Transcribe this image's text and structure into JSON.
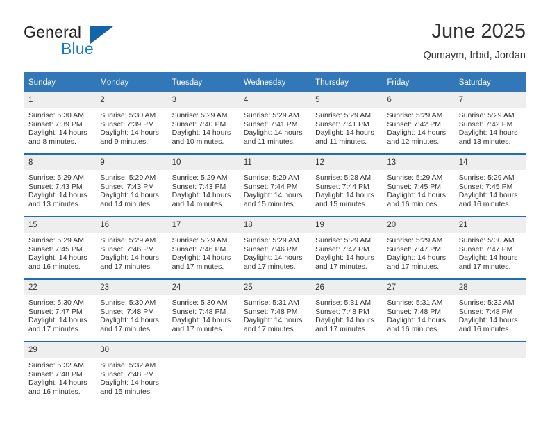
{
  "brand": {
    "word1": "General",
    "word2": "Blue",
    "triangle_color": "#1464aa",
    "blue_text_color": "#1878c8"
  },
  "header": {
    "title": "June 2025",
    "subtitle": "Qumaym, Irbid, Jordan"
  },
  "theme": {
    "header_bg": "#3277b8",
    "row_divider": "#1f6db5",
    "daynum_bg": "#eeeeee",
    "text": "#333333"
  },
  "labels": {
    "sunrise_prefix": "Sunrise:",
    "sunset_prefix": "Sunset:",
    "daylight_prefix": "Daylight:"
  },
  "weekdays": [
    "Sunday",
    "Monday",
    "Tuesday",
    "Wednesday",
    "Thursday",
    "Friday",
    "Saturday"
  ],
  "weeks": [
    [
      {
        "day": "1",
        "sunrise": "Sunrise: 5:30 AM",
        "sunset": "Sunset: 7:39 PM",
        "daylight_l1": "Daylight: 14 hours",
        "daylight_l2": "and 8 minutes."
      },
      {
        "day": "2",
        "sunrise": "Sunrise: 5:30 AM",
        "sunset": "Sunset: 7:39 PM",
        "daylight_l1": "Daylight: 14 hours",
        "daylight_l2": "and 9 minutes."
      },
      {
        "day": "3",
        "sunrise": "Sunrise: 5:29 AM",
        "sunset": "Sunset: 7:40 PM",
        "daylight_l1": "Daylight: 14 hours",
        "daylight_l2": "and 10 minutes."
      },
      {
        "day": "4",
        "sunrise": "Sunrise: 5:29 AM",
        "sunset": "Sunset: 7:41 PM",
        "daylight_l1": "Daylight: 14 hours",
        "daylight_l2": "and 11 minutes."
      },
      {
        "day": "5",
        "sunrise": "Sunrise: 5:29 AM",
        "sunset": "Sunset: 7:41 PM",
        "daylight_l1": "Daylight: 14 hours",
        "daylight_l2": "and 11 minutes."
      },
      {
        "day": "6",
        "sunrise": "Sunrise: 5:29 AM",
        "sunset": "Sunset: 7:42 PM",
        "daylight_l1": "Daylight: 14 hours",
        "daylight_l2": "and 12 minutes."
      },
      {
        "day": "7",
        "sunrise": "Sunrise: 5:29 AM",
        "sunset": "Sunset: 7:42 PM",
        "daylight_l1": "Daylight: 14 hours",
        "daylight_l2": "and 13 minutes."
      }
    ],
    [
      {
        "day": "8",
        "sunrise": "Sunrise: 5:29 AM",
        "sunset": "Sunset: 7:43 PM",
        "daylight_l1": "Daylight: 14 hours",
        "daylight_l2": "and 13 minutes."
      },
      {
        "day": "9",
        "sunrise": "Sunrise: 5:29 AM",
        "sunset": "Sunset: 7:43 PM",
        "daylight_l1": "Daylight: 14 hours",
        "daylight_l2": "and 14 minutes."
      },
      {
        "day": "10",
        "sunrise": "Sunrise: 5:29 AM",
        "sunset": "Sunset: 7:43 PM",
        "daylight_l1": "Daylight: 14 hours",
        "daylight_l2": "and 14 minutes."
      },
      {
        "day": "11",
        "sunrise": "Sunrise: 5:29 AM",
        "sunset": "Sunset: 7:44 PM",
        "daylight_l1": "Daylight: 14 hours",
        "daylight_l2": "and 15 minutes."
      },
      {
        "day": "12",
        "sunrise": "Sunrise: 5:28 AM",
        "sunset": "Sunset: 7:44 PM",
        "daylight_l1": "Daylight: 14 hours",
        "daylight_l2": "and 15 minutes."
      },
      {
        "day": "13",
        "sunrise": "Sunrise: 5:29 AM",
        "sunset": "Sunset: 7:45 PM",
        "daylight_l1": "Daylight: 14 hours",
        "daylight_l2": "and 16 minutes."
      },
      {
        "day": "14",
        "sunrise": "Sunrise: 5:29 AM",
        "sunset": "Sunset: 7:45 PM",
        "daylight_l1": "Daylight: 14 hours",
        "daylight_l2": "and 16 minutes."
      }
    ],
    [
      {
        "day": "15",
        "sunrise": "Sunrise: 5:29 AM",
        "sunset": "Sunset: 7:45 PM",
        "daylight_l1": "Daylight: 14 hours",
        "daylight_l2": "and 16 minutes."
      },
      {
        "day": "16",
        "sunrise": "Sunrise: 5:29 AM",
        "sunset": "Sunset: 7:46 PM",
        "daylight_l1": "Daylight: 14 hours",
        "daylight_l2": "and 17 minutes."
      },
      {
        "day": "17",
        "sunrise": "Sunrise: 5:29 AM",
        "sunset": "Sunset: 7:46 PM",
        "daylight_l1": "Daylight: 14 hours",
        "daylight_l2": "and 17 minutes."
      },
      {
        "day": "18",
        "sunrise": "Sunrise: 5:29 AM",
        "sunset": "Sunset: 7:46 PM",
        "daylight_l1": "Daylight: 14 hours",
        "daylight_l2": "and 17 minutes."
      },
      {
        "day": "19",
        "sunrise": "Sunrise: 5:29 AM",
        "sunset": "Sunset: 7:47 PM",
        "daylight_l1": "Daylight: 14 hours",
        "daylight_l2": "and 17 minutes."
      },
      {
        "day": "20",
        "sunrise": "Sunrise: 5:29 AM",
        "sunset": "Sunset: 7:47 PM",
        "daylight_l1": "Daylight: 14 hours",
        "daylight_l2": "and 17 minutes."
      },
      {
        "day": "21",
        "sunrise": "Sunrise: 5:30 AM",
        "sunset": "Sunset: 7:47 PM",
        "daylight_l1": "Daylight: 14 hours",
        "daylight_l2": "and 17 minutes."
      }
    ],
    [
      {
        "day": "22",
        "sunrise": "Sunrise: 5:30 AM",
        "sunset": "Sunset: 7:47 PM",
        "daylight_l1": "Daylight: 14 hours",
        "daylight_l2": "and 17 minutes."
      },
      {
        "day": "23",
        "sunrise": "Sunrise: 5:30 AM",
        "sunset": "Sunset: 7:48 PM",
        "daylight_l1": "Daylight: 14 hours",
        "daylight_l2": "and 17 minutes."
      },
      {
        "day": "24",
        "sunrise": "Sunrise: 5:30 AM",
        "sunset": "Sunset: 7:48 PM",
        "daylight_l1": "Daylight: 14 hours",
        "daylight_l2": "and 17 minutes."
      },
      {
        "day": "25",
        "sunrise": "Sunrise: 5:31 AM",
        "sunset": "Sunset: 7:48 PM",
        "daylight_l1": "Daylight: 14 hours",
        "daylight_l2": "and 17 minutes."
      },
      {
        "day": "26",
        "sunrise": "Sunrise: 5:31 AM",
        "sunset": "Sunset: 7:48 PM",
        "daylight_l1": "Daylight: 14 hours",
        "daylight_l2": "and 17 minutes."
      },
      {
        "day": "27",
        "sunrise": "Sunrise: 5:31 AM",
        "sunset": "Sunset: 7:48 PM",
        "daylight_l1": "Daylight: 14 hours",
        "daylight_l2": "and 16 minutes."
      },
      {
        "day": "28",
        "sunrise": "Sunrise: 5:32 AM",
        "sunset": "Sunset: 7:48 PM",
        "daylight_l1": "Daylight: 14 hours",
        "daylight_l2": "and 16 minutes."
      }
    ],
    [
      {
        "day": "29",
        "sunrise": "Sunrise: 5:32 AM",
        "sunset": "Sunset: 7:48 PM",
        "daylight_l1": "Daylight: 14 hours",
        "daylight_l2": "and 16 minutes."
      },
      {
        "day": "30",
        "sunrise": "Sunrise: 5:32 AM",
        "sunset": "Sunset: 7:48 PM",
        "daylight_l1": "Daylight: 14 hours",
        "daylight_l2": "and 15 minutes."
      },
      {
        "day": "",
        "sunrise": "",
        "sunset": "",
        "daylight_l1": "",
        "daylight_l2": ""
      },
      {
        "day": "",
        "sunrise": "",
        "sunset": "",
        "daylight_l1": "",
        "daylight_l2": ""
      },
      {
        "day": "",
        "sunrise": "",
        "sunset": "",
        "daylight_l1": "",
        "daylight_l2": ""
      },
      {
        "day": "",
        "sunrise": "",
        "sunset": "",
        "daylight_l1": "",
        "daylight_l2": ""
      },
      {
        "day": "",
        "sunrise": "",
        "sunset": "",
        "daylight_l1": "",
        "daylight_l2": ""
      }
    ]
  ]
}
